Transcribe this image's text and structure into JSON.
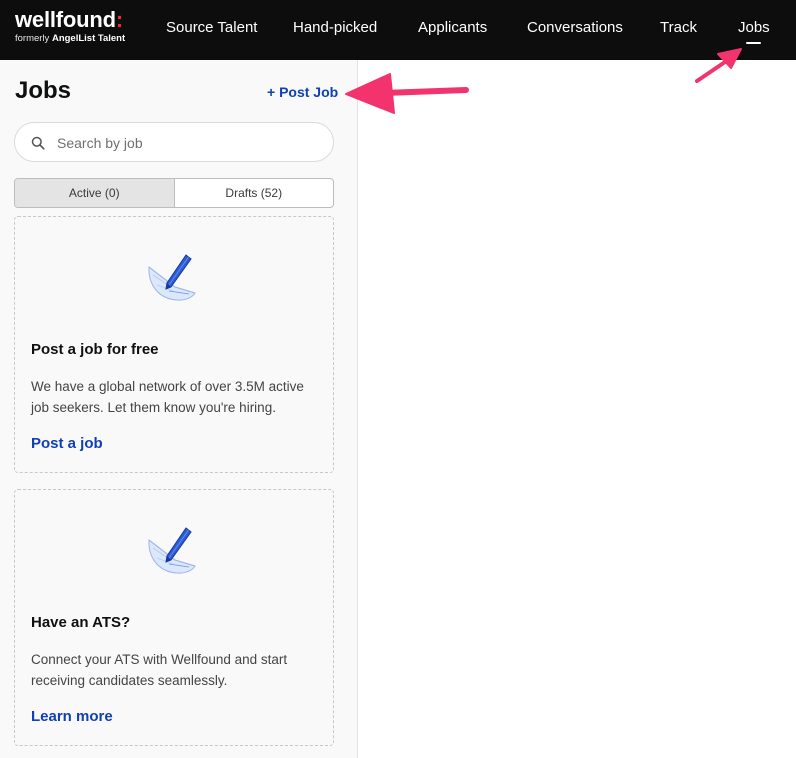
{
  "nav": {
    "logo": {
      "name": "wellfound",
      "colon": ":",
      "sub_prefix": "formerly ",
      "sub_brand": "AngelList Talent"
    },
    "items": [
      {
        "label": "Source Talent"
      },
      {
        "label": "Hand-picked"
      },
      {
        "label": "Applicants"
      },
      {
        "label": "Conversations"
      },
      {
        "label": "Track"
      },
      {
        "label": "Jobs",
        "active": true
      }
    ]
  },
  "sidebar": {
    "title": "Jobs",
    "post_job_label": "+ Post Job",
    "search": {
      "placeholder": "Search by job",
      "value": ""
    },
    "tabs": [
      {
        "label": "Active (0)",
        "active": true
      },
      {
        "label": "Drafts (52)",
        "active": false
      }
    ],
    "cards": [
      {
        "title": "Post a job for free",
        "text": "We have a global network of over 3.5M active job seekers. Let them know you're hiring.",
        "link": "Post a job",
        "icon": "pen-paper-icon"
      },
      {
        "title": "Have an ATS?",
        "text": "Connect your ATS with Wellfound and start receiving candidates seamlessly.",
        "link": "Learn more",
        "icon": "pen-paper-icon"
      }
    ]
  },
  "colors": {
    "nav_bg": "#0d0d0d",
    "accent_link": "#0f40b5",
    "logo_colon": "#ec2e3a",
    "annotation_arrow": "#f2336e"
  }
}
